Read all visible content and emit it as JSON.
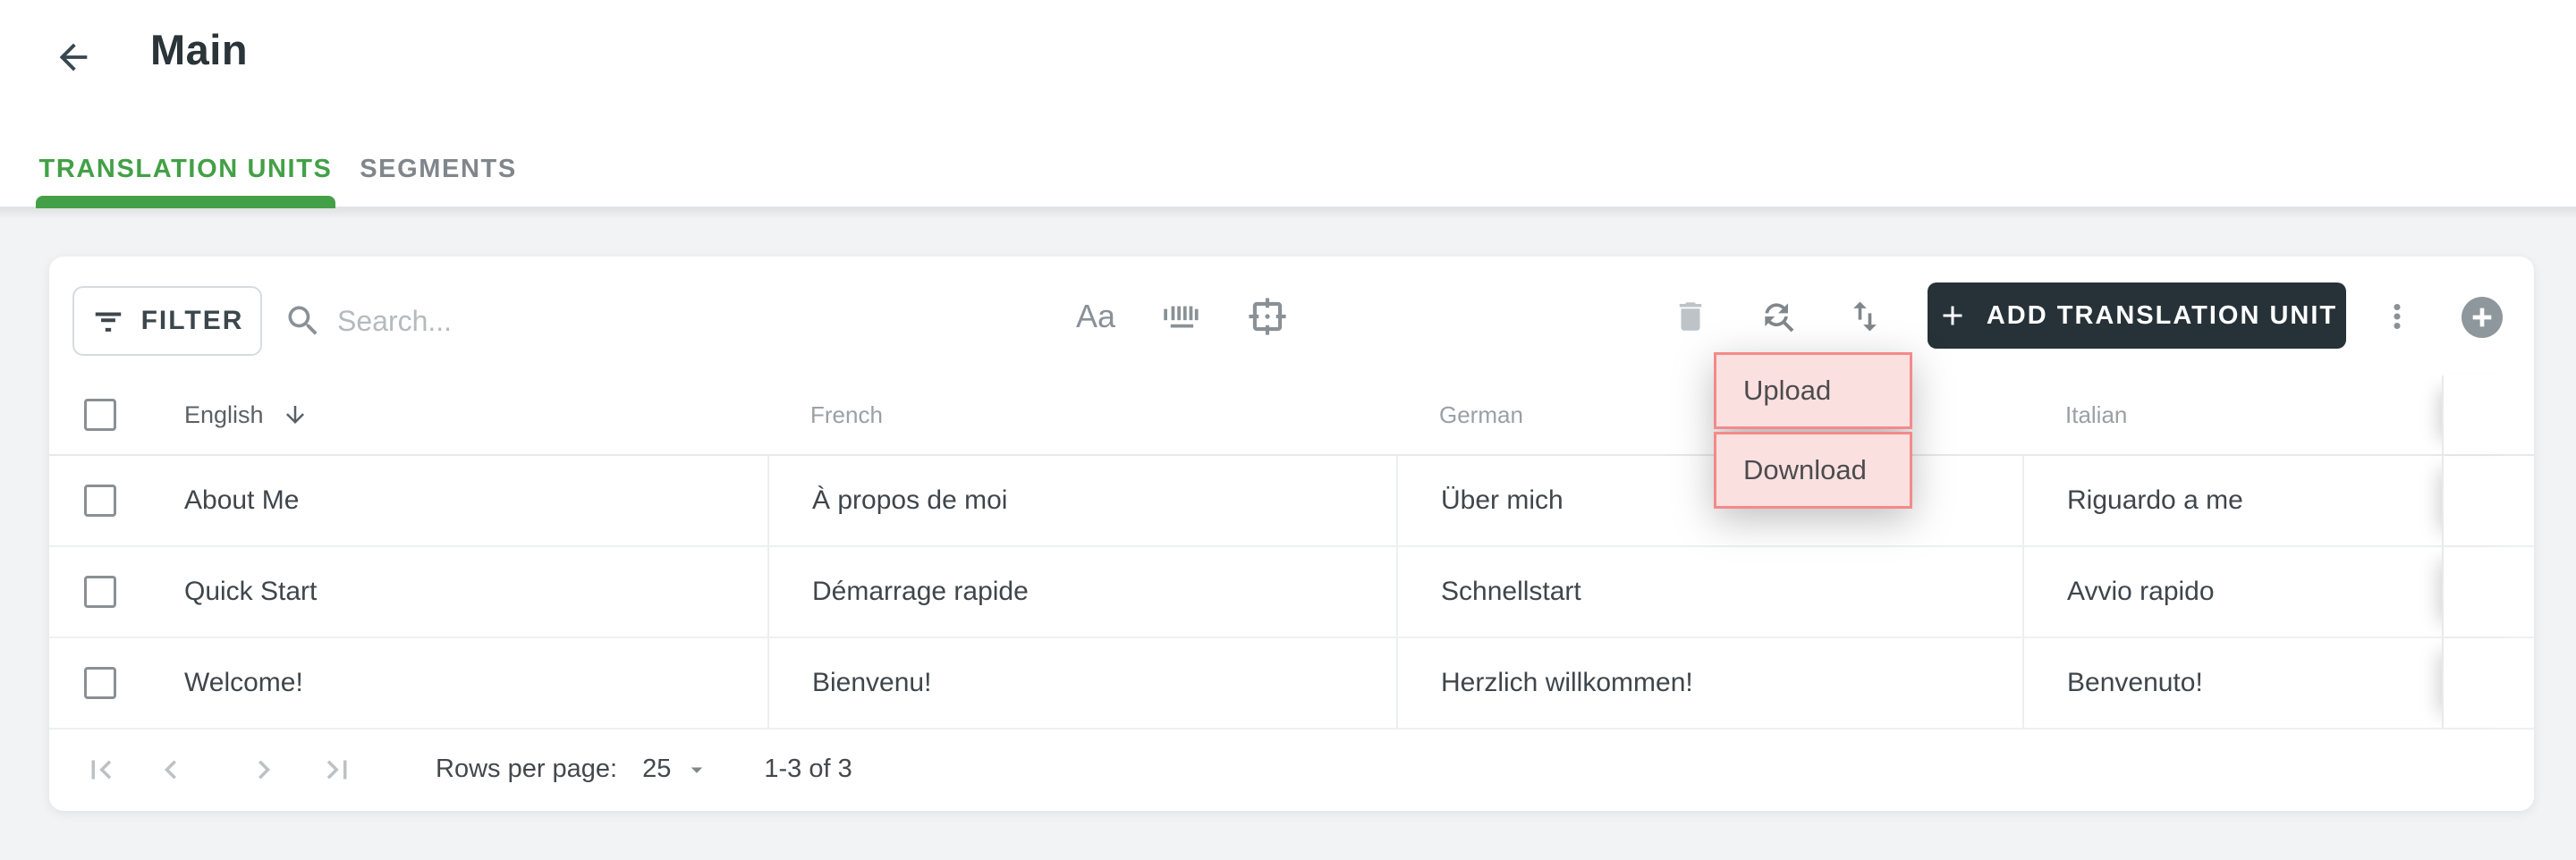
{
  "header": {
    "title": "Main"
  },
  "tabs": [
    {
      "label": "TRANSLATION UNITS",
      "active": true
    },
    {
      "label": "SEGMENTS",
      "active": false
    }
  ],
  "toolbar": {
    "filter_label": "FILTER",
    "search_placeholder": "Search...",
    "match_case_label": "Aa",
    "add_button_label": "ADD TRANSLATION UNIT",
    "icons": [
      "filter-icon",
      "search-icon",
      "match-case-icon",
      "whole-word-icon",
      "selection-frame-icon",
      "delete-icon",
      "find-replace-icon",
      "import-export-icon",
      "more-vert-icon",
      "add-circle-icon"
    ]
  },
  "menu": {
    "items": [
      {
        "label": "Upload"
      },
      {
        "label": "Download"
      }
    ],
    "highlight_border_color": "#f48a8a",
    "highlight_fill_color": "#fbe0e0"
  },
  "table": {
    "columns": [
      "English",
      "French",
      "German",
      "Italian"
    ],
    "sorted_column": "English",
    "sort_direction": "descending",
    "rows": [
      [
        "About Me",
        "À propos de moi",
        "Über mich",
        "Riguardo a me"
      ],
      [
        "Quick Start",
        "Démarrage rapide",
        "Schnellstart",
        "Avvio rapido"
      ],
      [
        "Welcome!",
        "Bienvenu!",
        "Herzlich willkommen!",
        "Benvenuto!"
      ]
    ]
  },
  "pagination": {
    "rows_per_page_label": "Rows per page:",
    "rows_per_page_value": "25",
    "range_label": "1-3 of 3"
  },
  "colors": {
    "accent_green": "#43a047",
    "dark_button": "#263238",
    "page_background": "#f1f3f4",
    "text_dark": "#3f464b",
    "text_muted": "#9aa0a5"
  }
}
